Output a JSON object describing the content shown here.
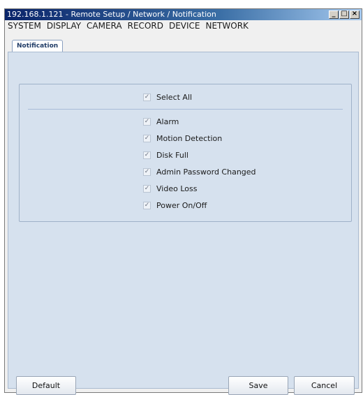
{
  "window": {
    "title": "192.168.1.121 - Remote Setup / Network / Notification"
  },
  "window_buttons": {
    "minimize_icon": "minimize-icon",
    "maximize_icon": "maximize-icon",
    "close_icon": "close-icon"
  },
  "menu": [
    "SYSTEM",
    "DISPLAY",
    "CAMERA",
    "RECORD",
    "DEVICE",
    "NETWORK"
  ],
  "tab": {
    "label": "Notification"
  },
  "select_all": {
    "label": "Select All",
    "checked": true
  },
  "options": [
    {
      "label": "Alarm",
      "checked": true
    },
    {
      "label": "Motion Detection",
      "checked": true
    },
    {
      "label": "Disk Full",
      "checked": true
    },
    {
      "label": "Admin Password Changed",
      "checked": true
    },
    {
      "label": "Video Loss",
      "checked": true
    },
    {
      "label": "Power On/Off",
      "checked": true
    }
  ],
  "buttons": {
    "default": "Default",
    "save": "Save",
    "cancel": "Cancel"
  },
  "colors": {
    "titlebar": "#0a246a",
    "panel": "#d6e1ee",
    "accent": "#1f3b66"
  }
}
